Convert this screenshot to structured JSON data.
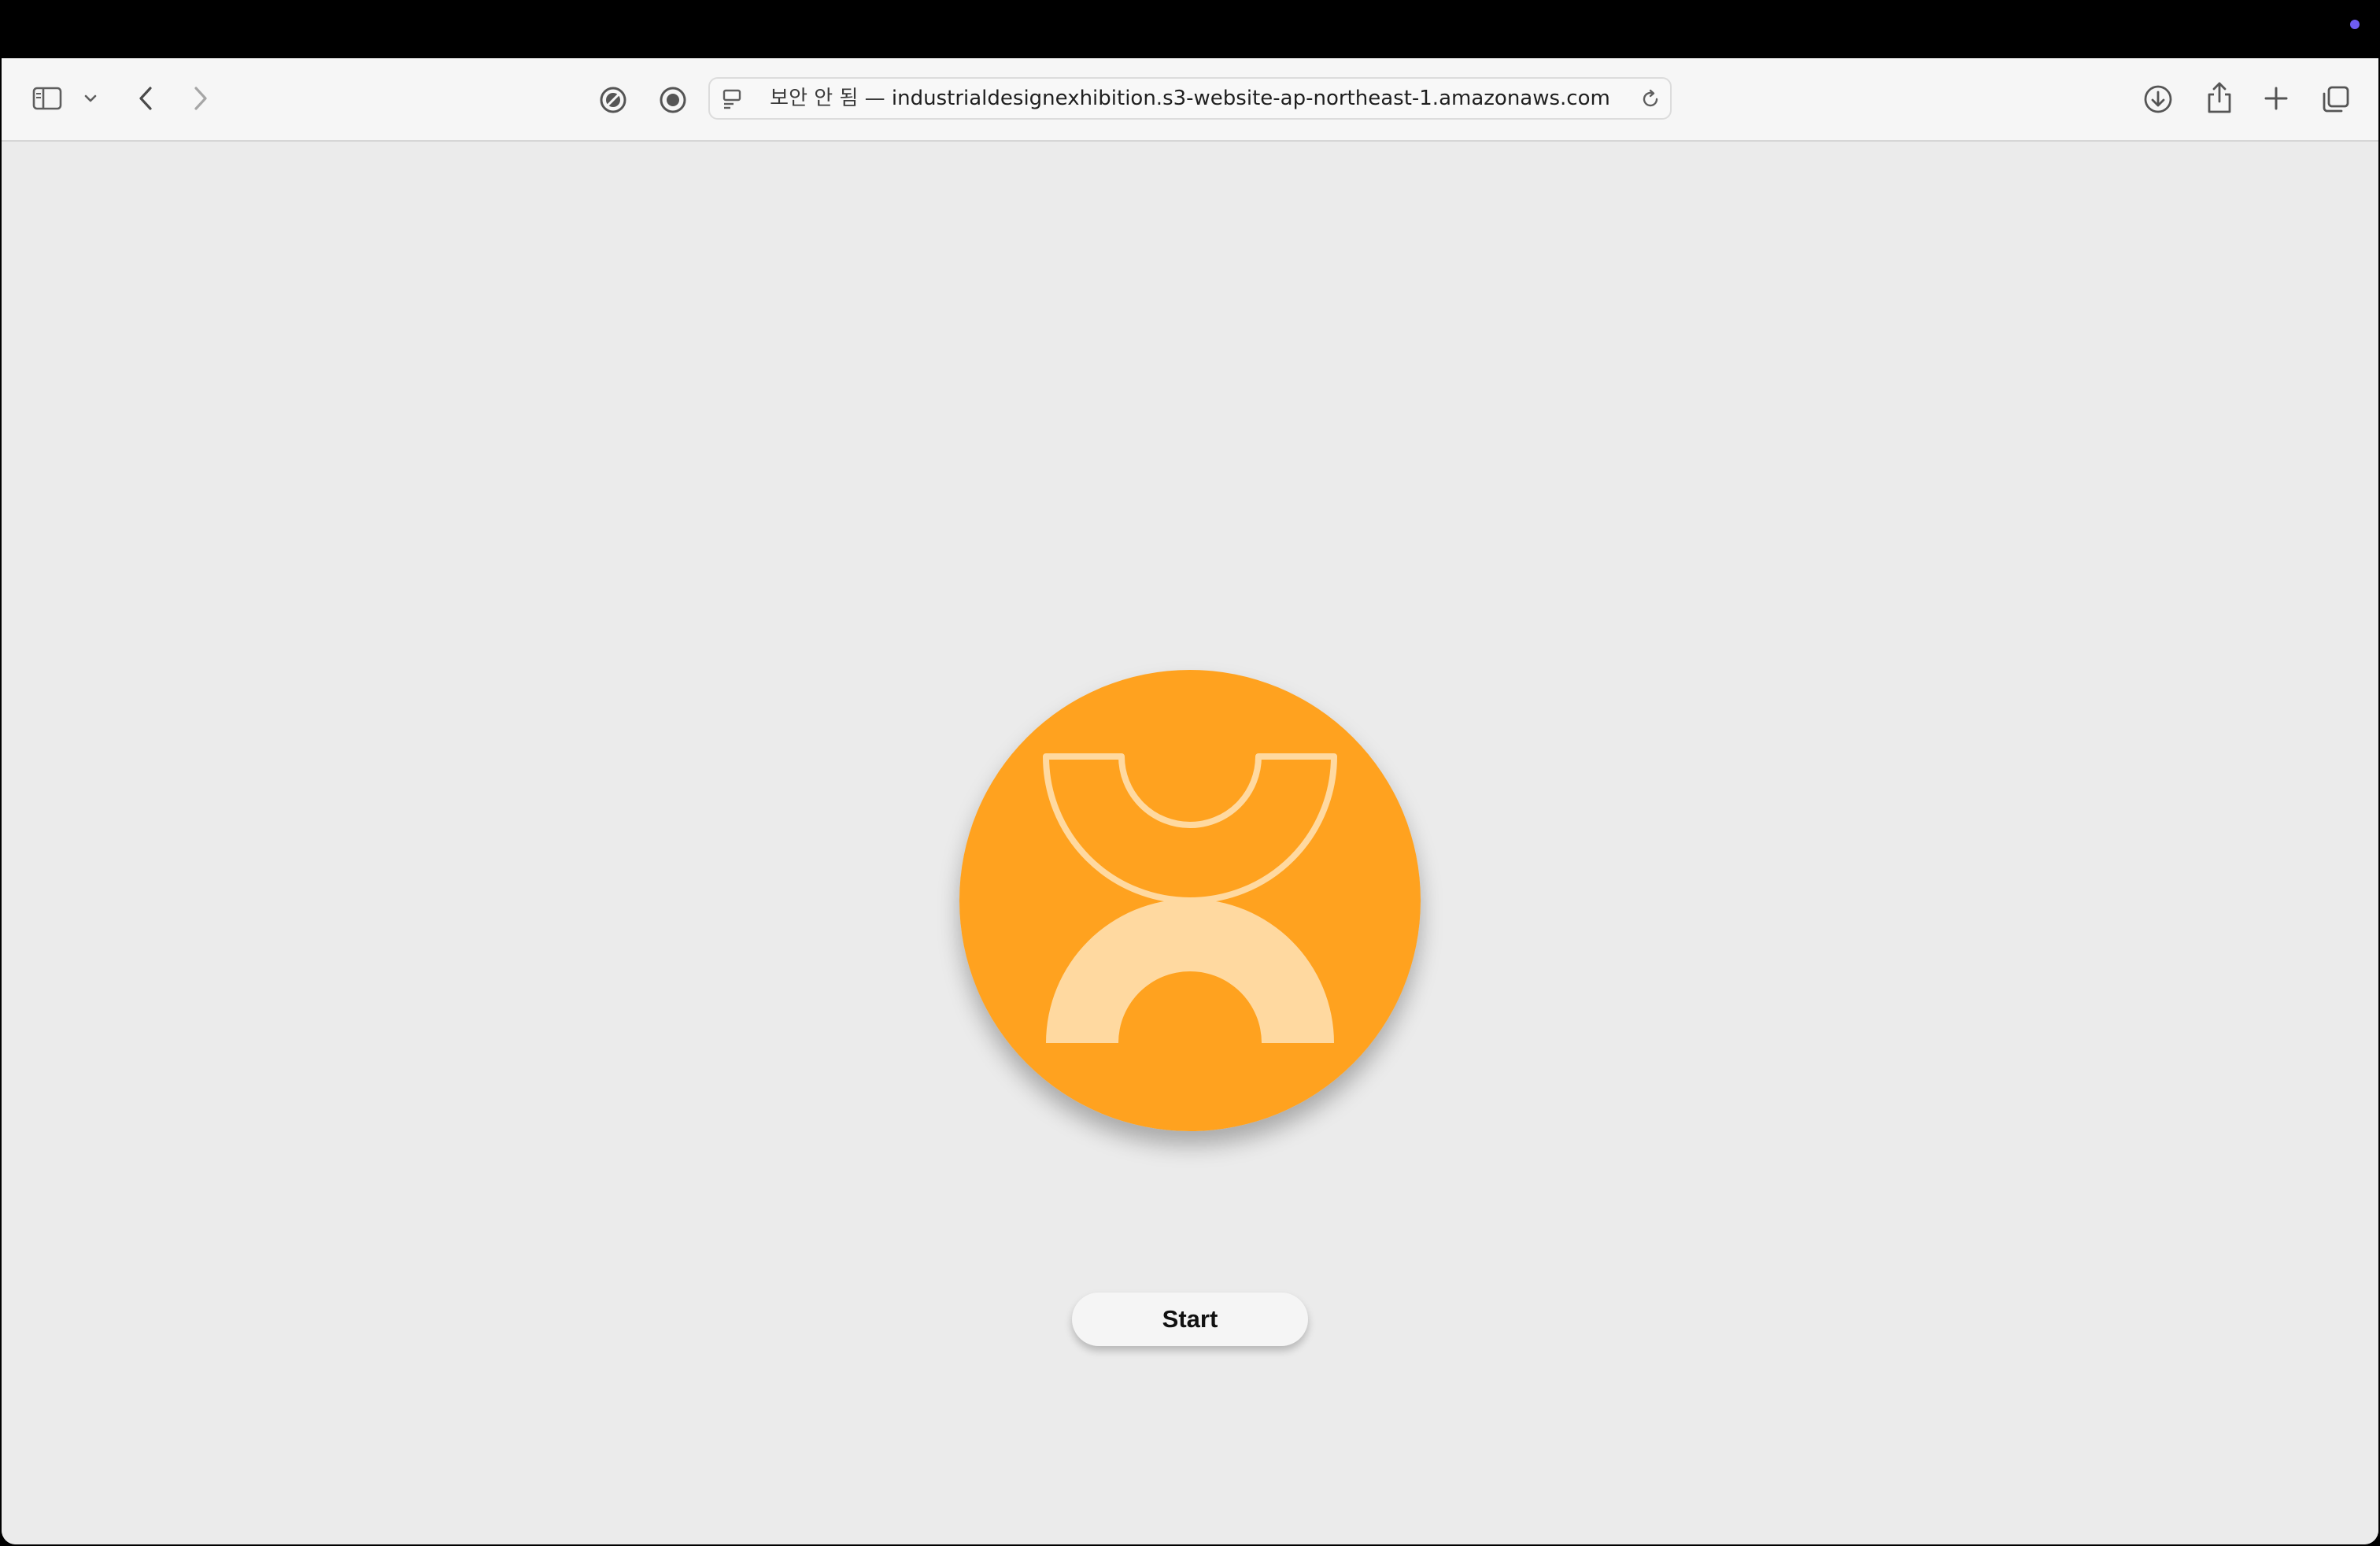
{
  "colors": {
    "menubar_bg": "#000000",
    "status_dot": "#6f5cf0",
    "page_bg": "#ebebeb",
    "logo_orange": "#ffa21f",
    "logo_cream": "#ffd9a0",
    "button_bg": "#f5f5f5"
  },
  "menubar": {
    "status_indicator_icon": "purple-dot-icon"
  },
  "toolbar": {
    "sidebar_toggle_icon": "sidebar-icon",
    "tab_group_chevron_icon": "chevron-down-icon",
    "back_icon": "chevron-left-icon",
    "forward_icon": "chevron-right-icon",
    "privacy_icon": "privacy-report-icon",
    "extension_icon": "record-icon",
    "page_menu_icon": "page-menu-icon",
    "reload_icon": "reload-icon",
    "download_icon": "download-icon",
    "share_icon": "share-icon",
    "new_tab_icon": "plus-icon",
    "tab_overview_icon": "tab-overview-icon"
  },
  "address_bar": {
    "security_label": "보안 안 됨",
    "separator": " — ",
    "domain": "industrialdesignexhibition.s3-website-ap-northeast-1.amazonaws.com"
  },
  "main": {
    "logo_icon": "exhibition-logo",
    "start_button_label": "Start"
  }
}
